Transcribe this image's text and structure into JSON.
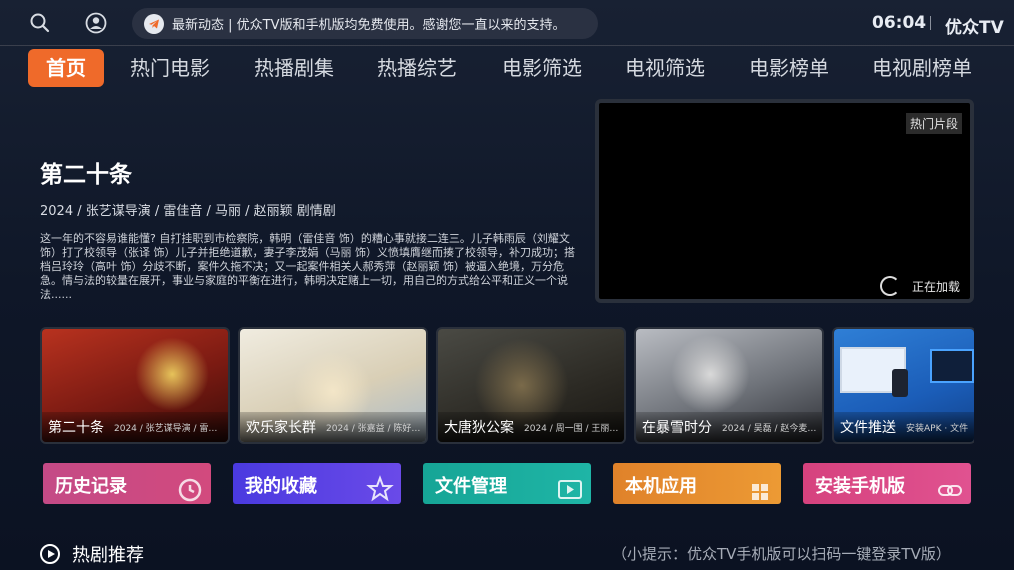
{
  "header": {
    "notice": "最新动态 | 优众TV版和手机版均免费使用。感谢您一直以来的支持。",
    "clock": "06:04",
    "brand": "优众TV",
    "separator": "I"
  },
  "nav": {
    "items": [
      "首页",
      "热门电影",
      "热播剧集",
      "热播综艺",
      "电影筛选",
      "电视筛选",
      "电影榜单",
      "电视剧榜单"
    ],
    "active": "首页"
  },
  "feature": {
    "title": "第二十条",
    "meta": "2024 / 张艺谋导演 /  雷佳音 / 马丽 / 赵丽颖 剧情剧",
    "description": "这一年的不容易谁能懂? 自打挂职到市检察院，韩明（雷佳音 饰）的糟心事就接二连三。儿子韩雨辰（刘耀文 饰）打了校领导（张译 饰）儿子并拒绝道歉，妻子李茂娟（马丽 饰）义愤填膺继而揍了校领导，补刀成功；搭档吕玲玲（高叶 饰）分歧不断，案件久拖不决；又一起案件相关人郝秀萍（赵丽颖 饰）被逼入绝境，万分危急。情与法的较量在展开，事业与家庭的平衡在进行，韩明决定赌上一切，用自己的方式给公平和正义一个说法......"
  },
  "player": {
    "tag": "热门片段",
    "loading": "正在加载"
  },
  "posters": [
    {
      "title": "第二十条",
      "meta": "2024 / 张艺谋导演 / 雷…"
    },
    {
      "title": "欢乐家长群",
      "meta": "2024 / 张嘉益 / 陈好…"
    },
    {
      "title": "大唐狄公案",
      "meta": "2024 / 周一围 / 王丽…"
    },
    {
      "title": "在暴雪时分",
      "meta": "2024 / 吴磊 / 赵今麦…"
    },
    {
      "title": "文件推送",
      "meta": "安装APK · 文件"
    }
  ],
  "quick": [
    {
      "label": "历史记录",
      "icon": "history-icon",
      "color": "#c84a8a"
    },
    {
      "label": "我的收藏",
      "icon": "star-icon",
      "color": "#5a3be0"
    },
    {
      "label": "文件管理",
      "icon": "folder-play-icon",
      "color": "#18a89a"
    },
    {
      "label": "本机应用",
      "icon": "apps-icon",
      "color": "#e48a2a"
    },
    {
      "label": "安装手机版",
      "icon": "link-icon",
      "color": "#d84a8a"
    }
  ],
  "section": {
    "title": "热剧推荐",
    "tip": "（小提示：优众TV手机版可以扫码一键登录TV版）"
  }
}
